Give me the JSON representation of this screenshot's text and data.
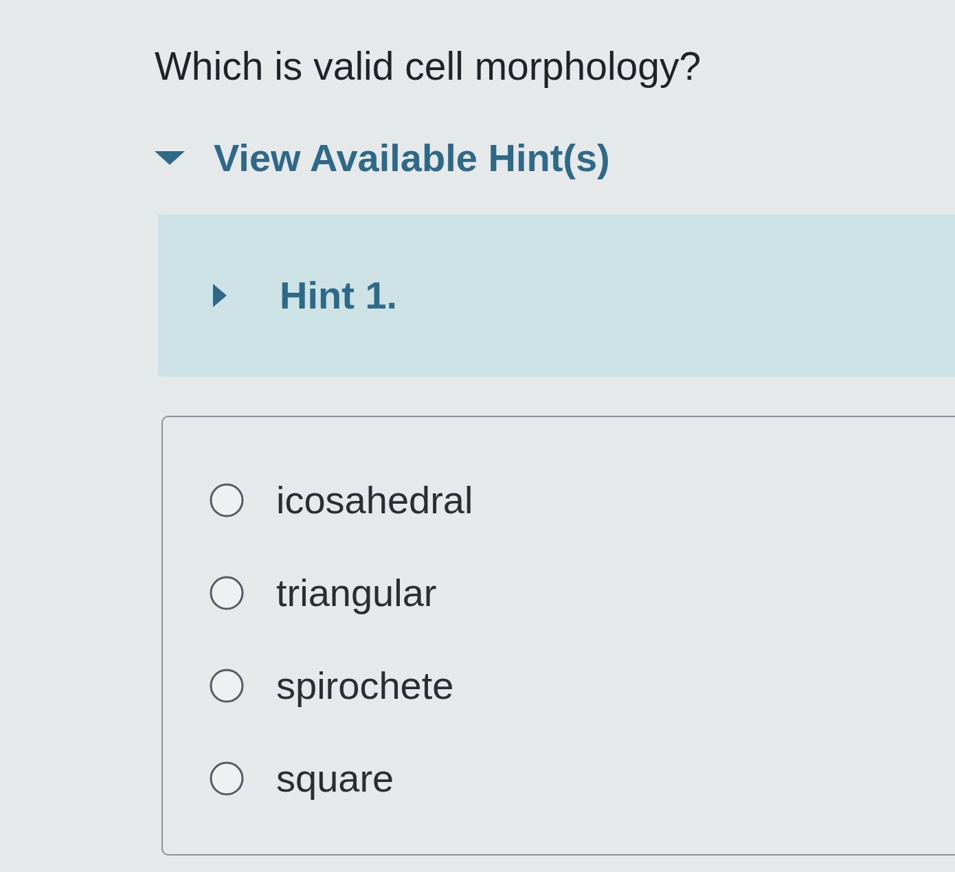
{
  "question": {
    "text": "Which is valid cell morphology?"
  },
  "hints": {
    "label": "View Available Hint(s)",
    "expanded": true,
    "items": [
      {
        "label": "Hint 1.",
        "expanded": false
      }
    ]
  },
  "answer_choices": [
    {
      "label": "icosahedral",
      "selected": false
    },
    {
      "label": "triangular",
      "selected": false
    },
    {
      "label": "spirochete",
      "selected": false
    },
    {
      "label": "square",
      "selected": false
    }
  ]
}
